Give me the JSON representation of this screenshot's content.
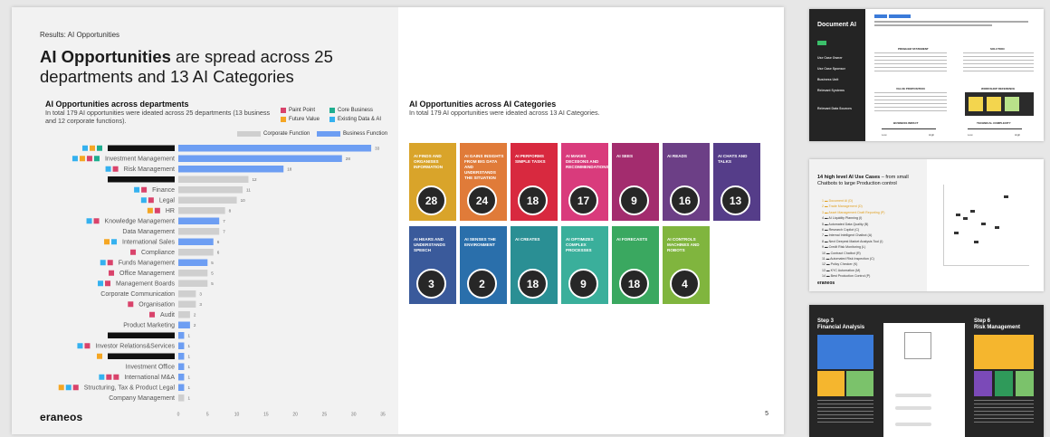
{
  "slide": {
    "breadcrumb": "Results: AI Opportunities",
    "headline_bold": "AI Opportunities",
    "headline_rest": " are spread across 25 departments and 13 AI Categories",
    "logo": "eraneos",
    "page_number": "5"
  },
  "departments_section": {
    "title": "AI Opportunities across departments",
    "subtitle": "In total 179 AI opportunities were ideated across 25 departments (13 business and 12 corporate functions)."
  },
  "categories_section": {
    "title": "AI Opportunities across AI Categories",
    "subtitle": "In total 179 AI opportunities were ideated across 13 AI Categories."
  },
  "legend": {
    "markers": [
      {
        "label": "Paint Point",
        "color": "#d9436b"
      },
      {
        "label": "Core Business",
        "color": "#1fae8f"
      },
      {
        "label": "Future Value",
        "color": "#f5a623"
      },
      {
        "label": "Existing Data & AI",
        "color": "#35b1ef"
      }
    ],
    "bars": [
      {
        "label": "Corporate Function",
        "color": "#cfcfcf"
      },
      {
        "label": "Business Function",
        "color": "#6d9ef3"
      }
    ]
  },
  "chart_data": [
    {
      "type": "bar",
      "orientation": "horizontal",
      "title": "AI Opportunities across departments",
      "xlim": [
        0,
        35
      ],
      "xticks": [
        0,
        5,
        10,
        15,
        20,
        25,
        30,
        35
      ],
      "rows": [
        {
          "label": "",
          "redacted": true,
          "value": 33,
          "function": "Business Function",
          "markers": [
            "#35b1ef",
            "#f5a623",
            "#1fae8f"
          ]
        },
        {
          "label": "Investment Management",
          "value": 28,
          "function": "Business Function",
          "markers": [
            "#35b1ef",
            "#f5a623",
            "#d9436b",
            "#1fae8f"
          ]
        },
        {
          "label": "Risk Management",
          "value": 18,
          "function": "Business Function",
          "markers": [
            "#35b1ef",
            "#d9436b"
          ]
        },
        {
          "label": "",
          "redacted": true,
          "value": 12,
          "function": "Corporate Function",
          "markers": []
        },
        {
          "label": "Finance",
          "value": 11,
          "function": "Corporate Function",
          "markers": [
            "#35b1ef",
            "#d9436b"
          ]
        },
        {
          "label": "Legal",
          "value": 10,
          "function": "Corporate Function",
          "markers": [
            "#35b1ef",
            "#d9436b"
          ]
        },
        {
          "label": "HR",
          "value": 8,
          "function": "Corporate Function",
          "markers": [
            "#f5a623",
            "#d9436b"
          ]
        },
        {
          "label": "Knowledge Management",
          "value": 7,
          "function": "Business Function",
          "markers": [
            "#35b1ef",
            "#d9436b"
          ]
        },
        {
          "label": "Data Management",
          "value": 7,
          "function": "Corporate Function",
          "markers": []
        },
        {
          "label": "International Sales",
          "value": 6,
          "function": "Business Function",
          "markers": [
            "#f5a623",
            "#35b1ef"
          ]
        },
        {
          "label": "Compliance",
          "value": 6,
          "function": "Corporate Function",
          "markers": [
            "#d9436b"
          ]
        },
        {
          "label": "Funds Management",
          "value": 5,
          "function": "Business Function",
          "markers": [
            "#35b1ef",
            "#d9436b"
          ]
        },
        {
          "label": "Office Management",
          "value": 5,
          "function": "Corporate Function",
          "markers": [
            "#d9436b"
          ]
        },
        {
          "label": "Management Boards",
          "value": 5,
          "function": "Corporate Function",
          "markers": [
            "#35b1ef",
            "#d9436b"
          ]
        },
        {
          "label": "Corporate Communication",
          "value": 3,
          "function": "Corporate Function",
          "markers": []
        },
        {
          "label": "Organisation",
          "value": 3,
          "function": "Corporate Function",
          "markers": [
            "#d9436b"
          ]
        },
        {
          "label": "Audit",
          "value": 2,
          "function": "Corporate Function",
          "markers": [
            "#d9436b"
          ]
        },
        {
          "label": "Product Marketing",
          "value": 2,
          "function": "Business Function",
          "markers": []
        },
        {
          "label": "",
          "redacted": true,
          "value": 1,
          "function": "Business Function",
          "markers": []
        },
        {
          "label": "Investor Relations&Services",
          "value": 1,
          "function": "Business Function",
          "markers": [
            "#35b1ef",
            "#d9436b"
          ]
        },
        {
          "label": "",
          "redacted": true,
          "value": 1,
          "function": "Business Function",
          "markers": [
            "#f5a623"
          ]
        },
        {
          "label": "Investment Office",
          "value": 1,
          "function": "Business Function",
          "markers": []
        },
        {
          "label": "International M&A",
          "value": 1,
          "function": "Business Function",
          "markers": [
            "#35b1ef",
            "#d9436b",
            "#d9436b"
          ]
        },
        {
          "label": "Structuring, Tax & Product Legal",
          "value": 1,
          "function": "Business Function",
          "markers": [
            "#f5a623",
            "#35b1ef",
            "#d9436b"
          ]
        },
        {
          "label": "Company Management",
          "value": 1,
          "function": "Corporate Function",
          "markers": []
        }
      ]
    },
    {
      "type": "table",
      "title": "AI Opportunities across AI Categories",
      "categories": [
        {
          "label": "AI Finds and Organises Information",
          "value": 28,
          "color": "#d9a42a"
        },
        {
          "label": "AI Gains Insights from Big Data and Understands the Situation",
          "value": 24,
          "color": "#e07b39"
        },
        {
          "label": "AI Performs Simple Tasks",
          "value": 18,
          "color": "#d8293f"
        },
        {
          "label": "AI Makes Decisions and Recommendations",
          "value": 17,
          "color": "#d93b7c"
        },
        {
          "label": "AI Sees",
          "value": 9,
          "color": "#a32c6e"
        },
        {
          "label": "AI Reads",
          "value": 16,
          "color": "#6c3f86"
        },
        {
          "label": "AI Chats and Talks",
          "value": 13,
          "color": "#553d89"
        },
        {
          "label": "AI Hears and Understands Speech",
          "value": 3,
          "color": "#3a5a9b"
        },
        {
          "label": "AI Senses the Environment",
          "value": 2,
          "color": "#2a6fab"
        },
        {
          "label": "AI Creates",
          "value": 18,
          "color": "#2a8f94"
        },
        {
          "label": "AI Optimizes Complex Processes",
          "value": 9,
          "color": "#3aaf9b"
        },
        {
          "label": "AI Forecasts",
          "value": 18,
          "color": "#3aa860"
        },
        {
          "label": "AI Controls Machines and Robots",
          "value": 4,
          "color": "#80b53e"
        }
      ]
    }
  ],
  "thumbnails": {
    "doc_ai": {
      "title": "Document AI",
      "problem": "PROBLEM STATEMENT",
      "solution": "SOLUTION",
      "value": "VALUE PROPOSITION",
      "workshop": "WORKSHOP REFERENCE",
      "impact": "BUSINESS IMPACT",
      "complexity": "TECHNICAL COMPLEXITY",
      "low": "Low",
      "high": "High",
      "fields": [
        "Use Case Owner",
        "Use Case Sponsor",
        "Business Unit",
        "Relevant Systems",
        "Relevant Data Sources"
      ]
    },
    "usecases": {
      "title_bold": "14 high level AI Use Cases",
      "title_rest": " – from small Chatbots to large Production control",
      "items": [
        "Document AI (D)",
        "Trade Management (D)",
        "Asset Management Draft Reporting (P)",
        "AI Liquidity Planning (I)",
        "Automated Data Quality (B)",
        "Research Copilot (C)",
        "Internal Intelligent Chatbot (A)",
        "Next Deepest Market Analysis Tool (I)",
        "Credit Risk Monitoring (L)",
        "Contract Chatbot (R)",
        "Automated Risk Inspection (C)",
        "Policy Checker (K)",
        "KYC Automation (M)",
        "Best Production Control (P)"
      ],
      "logo": "eraneos"
    },
    "steps": {
      "step3": "Step 3",
      "step3_title": "Financial Analysis",
      "step6": "Step 6",
      "step6_title": "Risk Management"
    }
  }
}
